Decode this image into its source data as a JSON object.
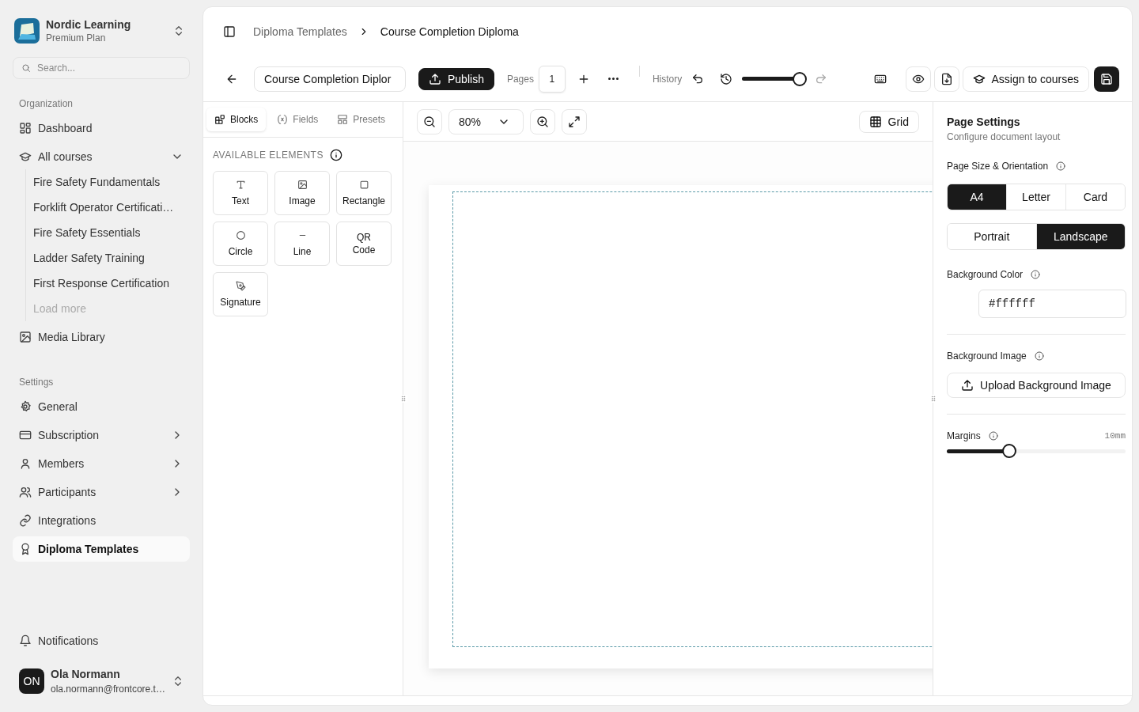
{
  "workspace": {
    "name": "Nordic Learning",
    "plan": "Premium Plan"
  },
  "search": {
    "placeholder": "Search..."
  },
  "nav_sections": [
    {
      "title": "Organization",
      "items": [
        {
          "label": "Dashboard",
          "selected": false
        },
        {
          "label": "All courses",
          "selected": false,
          "expanded": true,
          "children": [
            {
              "label": "Fire Safety Fundamentals",
              "disabled": false
            },
            {
              "label": "Forklift Operator Certificati…",
              "disabled": false
            },
            {
              "label": "Fire Safety Essentials",
              "disabled": false
            },
            {
              "label": "Ladder Safety Training",
              "disabled": false
            },
            {
              "label": "First Response Certification",
              "disabled": false
            },
            {
              "label": "Load more",
              "disabled": true
            }
          ]
        },
        {
          "label": "Media Library",
          "selected": false
        }
      ]
    },
    {
      "title": "Settings",
      "items": [
        {
          "label": "General",
          "selected": false
        },
        {
          "label": "Subscription",
          "selected": false,
          "expanded": false
        },
        {
          "label": "Members",
          "selected": false,
          "expanded": false
        },
        {
          "label": "Participants",
          "selected": false,
          "expanded": false
        },
        {
          "label": "Integrations",
          "selected": false
        },
        {
          "label": "Diploma Templates",
          "selected": true
        }
      ]
    }
  ],
  "notifications": {
    "label": "Notifications"
  },
  "user": {
    "initials": "ON",
    "name": "Ola Normann",
    "email": "ola.normann@frontcore.t…"
  },
  "breadcrumb": [
    "Diploma Templates",
    "Course Completion Diploma"
  ],
  "toolbar": {
    "title_value": "Course Completion Diplor",
    "publish": "Publish",
    "pages_label": "Pages",
    "page_number": "1",
    "history_label": "History",
    "history": {
      "level": 1
    },
    "assign": "Assign to courses"
  },
  "panel_tabs": [
    {
      "label": "Blocks",
      "selected": true
    },
    {
      "label": "Fields",
      "selected": false
    },
    {
      "label": "Presets",
      "selected": false
    }
  ],
  "elements_title": "AVAILABLE ELEMENTS",
  "elements": [
    "Text",
    "Image",
    "Rectangle",
    "Circle",
    "Line",
    "QR Code",
    "Signature"
  ],
  "canvas": {
    "zoom": "80%",
    "grid": "Grid"
  },
  "page_settings": {
    "title": "Page Settings",
    "subtitle": "Configure document layout",
    "size_label": "Page Size & Orientation",
    "sizes": [
      {
        "label": "A4",
        "selected": true
      },
      {
        "label": "Letter",
        "selected": false
      },
      {
        "label": "Card",
        "selected": false
      }
    ],
    "orientations": [
      {
        "label": "Portrait",
        "selected": false
      },
      {
        "label": "Landscape",
        "selected": true
      }
    ],
    "bg_color_label": "Background Color",
    "bg_color_value": "#ffffff",
    "bg_image_label": "Background Image",
    "upload": "Upload Background Image",
    "margins_label": "Margins",
    "margins_value": "10mm",
    "margins": {
      "level": 0.35
    }
  }
}
